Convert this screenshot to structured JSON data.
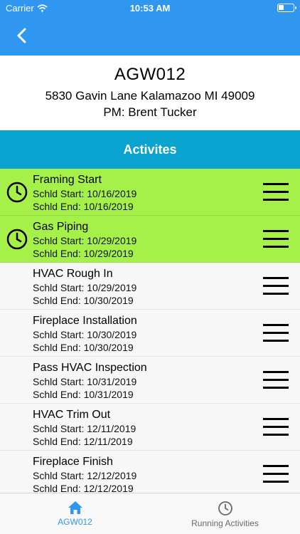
{
  "status_bar": {
    "carrier": "Carrier",
    "time": "10:53 AM"
  },
  "header": {
    "code": "AGW012",
    "address": "5830 Gavin Lane Kalamazoo MI 49009",
    "pm": "PM: Brent Tucker"
  },
  "section_title": "Activites",
  "activities": [
    {
      "title": "Framing Start",
      "start": "Schld Start: 10/16/2019",
      "end": "Schld End: 10/16/2019",
      "running": true
    },
    {
      "title": "Gas Piping",
      "start": "Schld Start: 10/29/2019",
      "end": "Schld End: 10/29/2019",
      "running": true
    },
    {
      "title": "HVAC Rough In",
      "start": "Schld Start: 10/29/2019",
      "end": "Schld End: 10/30/2019",
      "running": false
    },
    {
      "title": "Fireplace Installation",
      "start": "Schld Start: 10/30/2019",
      "end": "Schld End: 10/30/2019",
      "running": false
    },
    {
      "title": "Pass HVAC Inspection",
      "start": "Schld Start: 10/31/2019",
      "end": "Schld End: 10/31/2019",
      "running": false
    },
    {
      "title": "HVAC Trim Out",
      "start": "Schld Start: 12/11/2019",
      "end": "Schld End: 12/11/2019",
      "running": false
    },
    {
      "title": "Fireplace Finish",
      "start": "Schld Start: 12/12/2019",
      "end": "Schld End: 12/12/2019",
      "running": false
    }
  ],
  "tabs": {
    "home": "AGW012",
    "running": "Running Activities"
  },
  "colors": {
    "nav": "#2f97f0",
    "section": "#0aa3cf",
    "running_row": "#a6f04a"
  }
}
